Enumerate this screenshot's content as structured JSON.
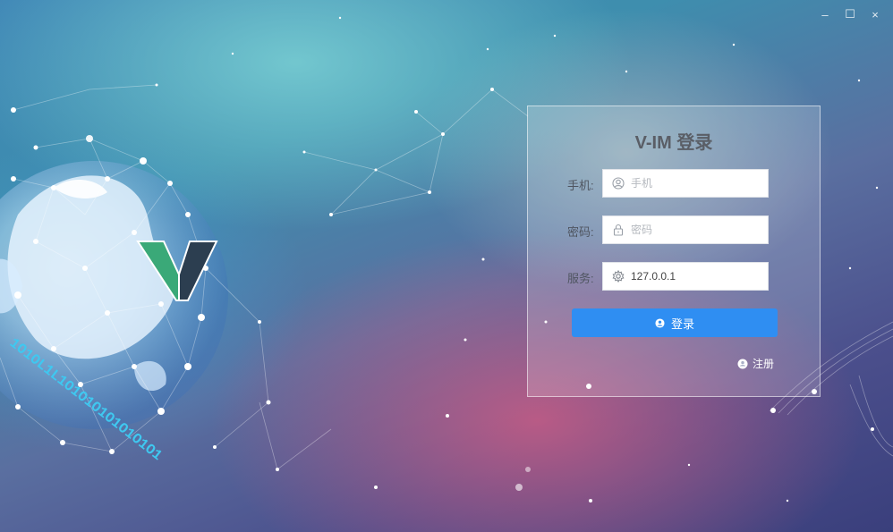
{
  "window": {
    "controls": [
      {
        "name": "minimize",
        "glyph": "–"
      },
      {
        "name": "maximize",
        "glyph": "☐"
      },
      {
        "name": "close",
        "glyph": "×"
      }
    ]
  },
  "logo": {
    "letter": "V",
    "colors": {
      "green": "#3aa978",
      "dark": "#2c3e50"
    }
  },
  "background": {
    "binary_text": "1O1OL1L1O1O1O1O1O1O1O1"
  },
  "login": {
    "title": "V-IM 登录",
    "phone": {
      "label": "手机:",
      "placeholder": "手机",
      "value": "",
      "icon": "user-icon"
    },
    "password": {
      "label": "密码:",
      "placeholder": "密码",
      "value": "",
      "icon": "lock-icon"
    },
    "server": {
      "label": "服务:",
      "placeholder": "",
      "value": "127.0.0.1",
      "icon": "gear-icon"
    },
    "login_button": "登录",
    "register_link": "注册"
  },
  "colors": {
    "primary": "#2f8ef2",
    "title": "#5a5e66"
  }
}
